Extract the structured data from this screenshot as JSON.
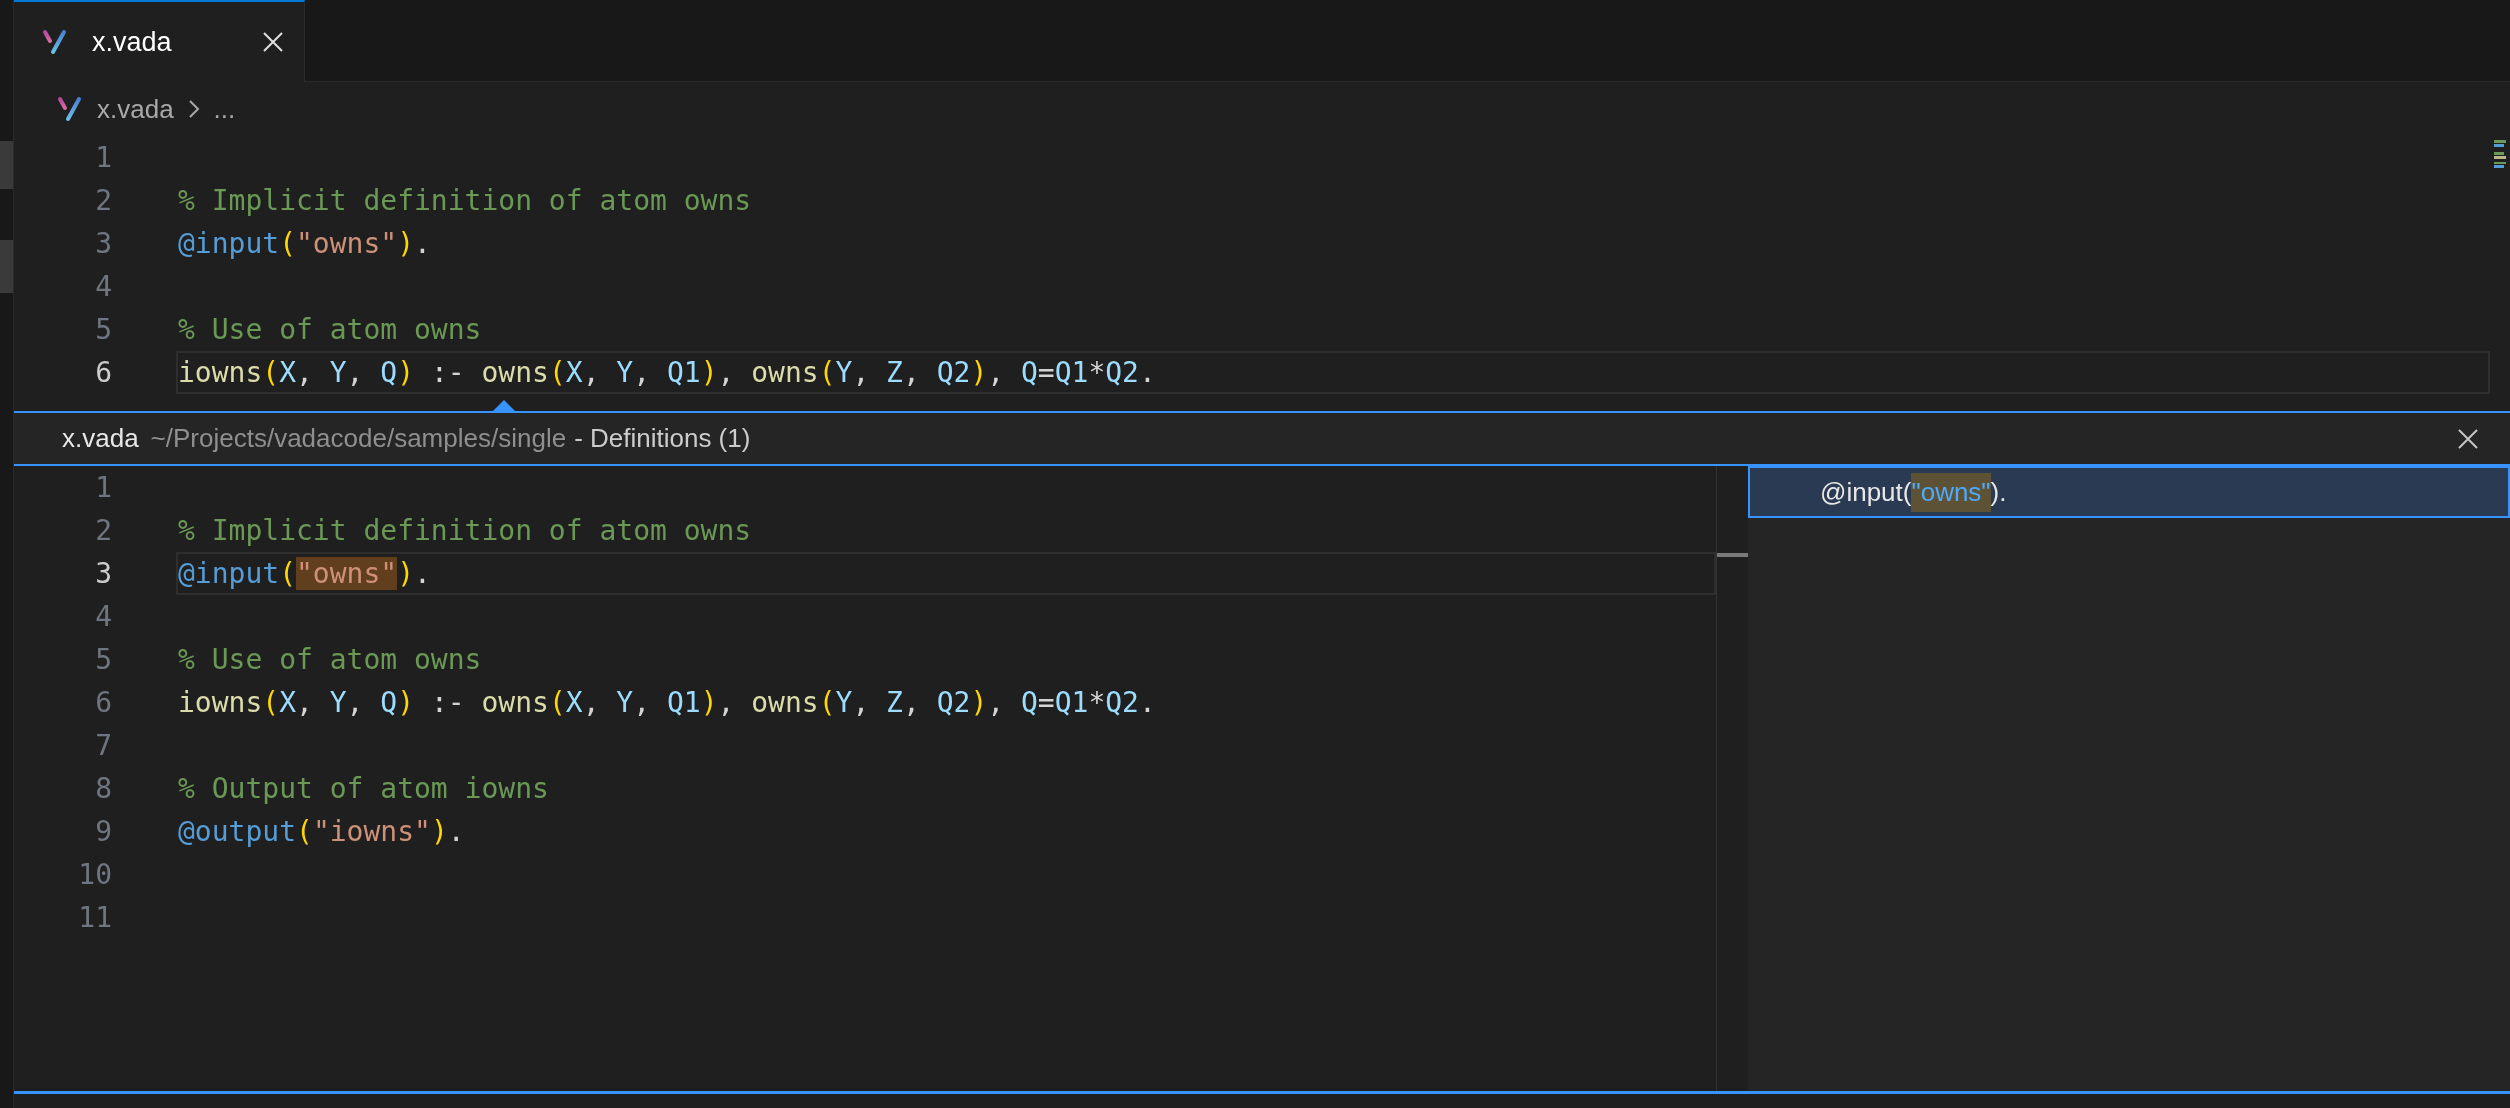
{
  "tabs": [
    {
      "label": "x.vada",
      "selected": true
    }
  ],
  "breadcrumb": {
    "file": "x.vada",
    "more": "..."
  },
  "editor": {
    "lines": [
      {
        "number": "1",
        "current": false
      },
      {
        "number": "2",
        "current": false,
        "tokens": [
          {
            "text": "% Implicit definition of atom owns",
            "kind": "comment"
          }
        ]
      },
      {
        "number": "3",
        "current": false,
        "tokens": [
          {
            "text": "@input",
            "kind": "decorator"
          },
          {
            "text": "(",
            "kind": "paren"
          },
          {
            "text": "\"owns\"",
            "kind": "string"
          },
          {
            "text": ")",
            "kind": "paren"
          },
          {
            "text": ".",
            "kind": "plain"
          }
        ]
      },
      {
        "number": "4",
        "current": false
      },
      {
        "number": "5",
        "current": false,
        "tokens": [
          {
            "text": "% Use of atom owns",
            "kind": "comment"
          }
        ]
      },
      {
        "number": "6",
        "current": true,
        "tokens": [
          {
            "text": "iowns",
            "kind": "function"
          },
          {
            "text": "(",
            "kind": "paren"
          },
          {
            "text": "X",
            "kind": "variable"
          },
          {
            "text": ", ",
            "kind": "plain"
          },
          {
            "text": "Y",
            "kind": "variable"
          },
          {
            "text": ", ",
            "kind": "plain"
          },
          {
            "text": "Q",
            "kind": "variable"
          },
          {
            "text": ")",
            "kind": "paren"
          },
          {
            "text": " :- ",
            "kind": "plain"
          },
          {
            "text": "owns",
            "kind": "function"
          },
          {
            "text": "(",
            "kind": "paren"
          },
          {
            "text": "X",
            "kind": "variable"
          },
          {
            "text": ", ",
            "kind": "plain"
          },
          {
            "text": "Y",
            "kind": "variable"
          },
          {
            "text": ", ",
            "kind": "plain"
          },
          {
            "text": "Q1",
            "kind": "variable"
          },
          {
            "text": ")",
            "kind": "paren"
          },
          {
            "text": ", ",
            "kind": "plain"
          },
          {
            "text": "owns",
            "kind": "function"
          },
          {
            "text": "(",
            "kind": "paren"
          },
          {
            "text": "Y",
            "kind": "variable"
          },
          {
            "text": ", ",
            "kind": "plain"
          },
          {
            "text": "Z",
            "kind": "variable"
          },
          {
            "text": ", ",
            "kind": "plain"
          },
          {
            "text": "Q2",
            "kind": "variable"
          },
          {
            "text": ")",
            "kind": "paren"
          },
          {
            "text": ", ",
            "kind": "plain"
          },
          {
            "text": "Q",
            "kind": "variable"
          },
          {
            "text": "=",
            "kind": "plain"
          },
          {
            "text": "Q1",
            "kind": "variable"
          },
          {
            "text": "*",
            "kind": "plain"
          },
          {
            "text": "Q2",
            "kind": "variable"
          },
          {
            "text": ".",
            "kind": "plain"
          }
        ]
      }
    ]
  },
  "peek": {
    "file": "x.vada",
    "path": "~/Projects/vadacode/samples/single",
    "title": "- Definitions (1)",
    "lines": [
      {
        "number": "1",
        "current": false
      },
      {
        "number": "2",
        "current": false,
        "tokens": [
          {
            "text": "% Implicit definition of atom owns",
            "kind": "comment"
          }
        ]
      },
      {
        "number": "3",
        "current": true,
        "tokens": [
          {
            "text": "@input",
            "kind": "decorator"
          },
          {
            "text": "(",
            "kind": "paren"
          },
          {
            "text": "\"owns\"",
            "kind": "match"
          },
          {
            "text": ")",
            "kind": "paren"
          },
          {
            "text": ".",
            "kind": "plain"
          }
        ]
      },
      {
        "number": "4",
        "current": false
      },
      {
        "number": "5",
        "current": false,
        "tokens": [
          {
            "text": "% Use of atom owns",
            "kind": "comment"
          }
        ]
      },
      {
        "number": "6",
        "current": false,
        "tokens": [
          {
            "text": "iowns",
            "kind": "function"
          },
          {
            "text": "(",
            "kind": "paren"
          },
          {
            "text": "X",
            "kind": "variable"
          },
          {
            "text": ", ",
            "kind": "plain"
          },
          {
            "text": "Y",
            "kind": "variable"
          },
          {
            "text": ", ",
            "kind": "plain"
          },
          {
            "text": "Q",
            "kind": "variable"
          },
          {
            "text": ")",
            "kind": "paren"
          },
          {
            "text": " :- ",
            "kind": "plain"
          },
          {
            "text": "owns",
            "kind": "function"
          },
          {
            "text": "(",
            "kind": "paren"
          },
          {
            "text": "X",
            "kind": "variable"
          },
          {
            "text": ", ",
            "kind": "plain"
          },
          {
            "text": "Y",
            "kind": "variable"
          },
          {
            "text": ", ",
            "kind": "plain"
          },
          {
            "text": "Q1",
            "kind": "variable"
          },
          {
            "text": ")",
            "kind": "paren"
          },
          {
            "text": ", ",
            "kind": "plain"
          },
          {
            "text": "owns",
            "kind": "function"
          },
          {
            "text": "(",
            "kind": "paren"
          },
          {
            "text": "Y",
            "kind": "variable"
          },
          {
            "text": ", ",
            "kind": "plain"
          },
          {
            "text": "Z",
            "kind": "variable"
          },
          {
            "text": ", ",
            "kind": "plain"
          },
          {
            "text": "Q2",
            "kind": "variable"
          },
          {
            "text": ")",
            "kind": "paren"
          },
          {
            "text": ", ",
            "kind": "plain"
          },
          {
            "text": "Q",
            "kind": "variable"
          },
          {
            "text": "=",
            "kind": "plain"
          },
          {
            "text": "Q1",
            "kind": "variable"
          },
          {
            "text": "*",
            "kind": "plain"
          },
          {
            "text": "Q2",
            "kind": "variable"
          },
          {
            "text": ".",
            "kind": "plain"
          }
        ]
      },
      {
        "number": "7",
        "current": false
      },
      {
        "number": "8",
        "current": false,
        "tokens": [
          {
            "text": "% Output of atom iowns",
            "kind": "comment"
          }
        ]
      },
      {
        "number": "9",
        "current": false,
        "tokens": [
          {
            "text": "@output",
            "kind": "decorator"
          },
          {
            "text": "(",
            "kind": "paren"
          },
          {
            "text": "\"iowns\"",
            "kind": "string"
          },
          {
            "text": ")",
            "kind": "paren"
          },
          {
            "text": ".",
            "kind": "plain"
          }
        ]
      },
      {
        "number": "10",
        "current": false
      },
      {
        "number": "11",
        "current": false
      }
    ],
    "references": [
      {
        "selected": true,
        "tokens": [
          {
            "text": "@input(",
            "kind": "plain"
          },
          {
            "text": "\"owns\"",
            "kind": "match"
          },
          {
            "text": ").",
            "kind": "plain"
          }
        ]
      }
    ]
  }
}
